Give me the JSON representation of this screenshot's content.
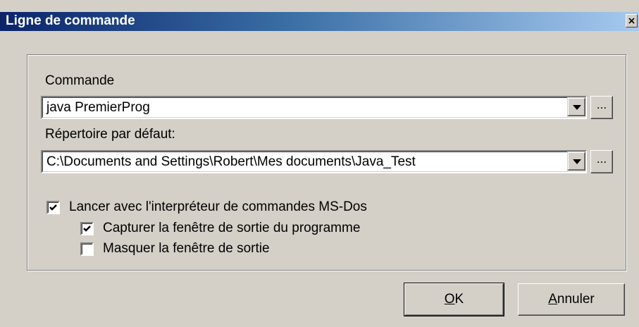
{
  "window": {
    "title": "Ligne de commande"
  },
  "command": {
    "label": "Commande",
    "value": "java PremierProg",
    "browse_label": "..."
  },
  "directory": {
    "label": "Répertoire par défaut:",
    "value": "C:\\Documents and Settings\\Robert\\Mes documents\\Java_Test",
    "browse_label": "..."
  },
  "options": {
    "launch_msdos": {
      "label": "Lancer avec l'interpréteur de commandes MS-Dos",
      "checked": true
    },
    "capture_output": {
      "label": "Capturer la fenêtre de sortie du programme",
      "checked": true
    },
    "hide_output": {
      "label": "Masquer la fenêtre de sortie",
      "checked": false
    }
  },
  "buttons": {
    "ok_mnemonic": "O",
    "ok_rest": "K",
    "cancel_mnemonic": "A",
    "cancel_rest": "nnuler"
  },
  "colors": {
    "title_start": "#0a246a",
    "title_end": "#a6caf0",
    "face": "#d4d0c8"
  }
}
